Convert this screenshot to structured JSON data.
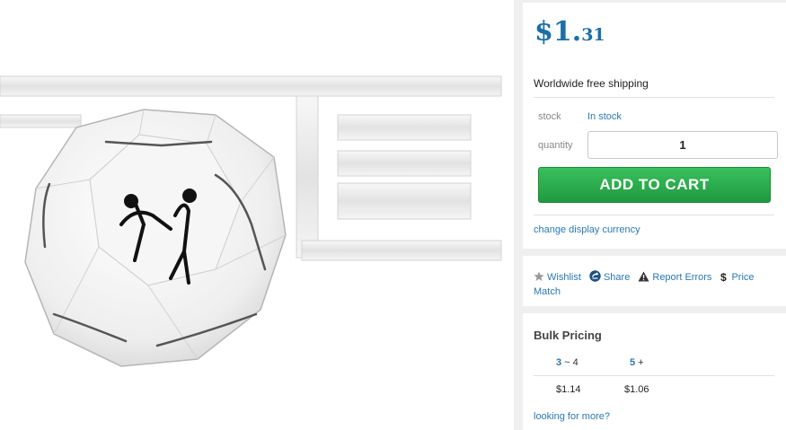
{
  "product_image": {
    "alt_icon": "product-photo"
  },
  "price": {
    "currency": "$",
    "main": "1.",
    "cents": "31"
  },
  "shipping": "Worldwide free shipping",
  "stock": {
    "label": "stock",
    "value": "In stock"
  },
  "quantity": {
    "label": "quantity",
    "value": "1"
  },
  "add_to_cart": "ADD TO CART",
  "change_currency": "change display currency",
  "actions": [
    {
      "label": "Wishlist",
      "icon": "star-icon"
    },
    {
      "label": "Share",
      "icon": "share-icon"
    },
    {
      "label": "Report Errors",
      "icon": "warning-icon"
    },
    {
      "label": "Price Match",
      "icon": "dollar-icon"
    }
  ],
  "bulk": {
    "title": "Bulk Pricing",
    "tiers": [
      {
        "qty": "3",
        "range_suffix": "~ 4",
        "price": "$1.14"
      },
      {
        "qty": "5",
        "range_suffix": "+",
        "price": "$1.06"
      }
    ],
    "more": "looking for more?"
  },
  "colors": {
    "accent": "#1a6fa8",
    "link": "#2a78b5",
    "button": "#24a648"
  }
}
